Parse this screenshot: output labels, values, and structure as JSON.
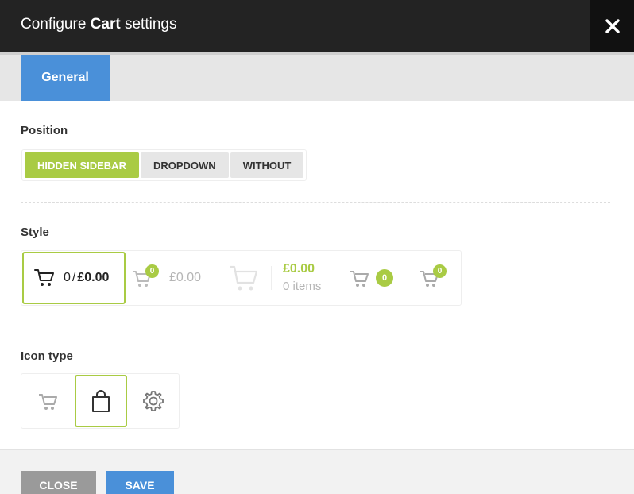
{
  "dialog": {
    "title_prefix": "Configure",
    "title_bold": "Cart",
    "title_suffix": "settings",
    "close_icon": "close-icon"
  },
  "tabs": [
    {
      "label": "General",
      "active": true
    }
  ],
  "position": {
    "label": "Position",
    "options": [
      "HIDDEN SIDEBAR",
      "DROPDOWN",
      "WITHOUT"
    ],
    "selected": "HIDDEN SIDEBAR"
  },
  "style": {
    "label": "Style",
    "option1": {
      "count": "0",
      "separator": "/",
      "amount": "£0.00"
    },
    "option2": {
      "badge": "0",
      "amount": "£0.00"
    },
    "option3": {
      "amount": "£0.00",
      "items": "0 items"
    },
    "option4": {
      "badge": "0"
    },
    "option5": {
      "badge": "0"
    }
  },
  "icon_type": {
    "label": "Icon type",
    "options": [
      "cart-icon",
      "bag-icon",
      "gear-icon"
    ],
    "selected": "bag-icon"
  },
  "footer": {
    "close_label": "CLOSE",
    "save_label": "SAVE"
  },
  "colors": {
    "accent_green": "#a9cb44",
    "accent_blue": "#4a90d9",
    "titlebar": "#232323"
  }
}
